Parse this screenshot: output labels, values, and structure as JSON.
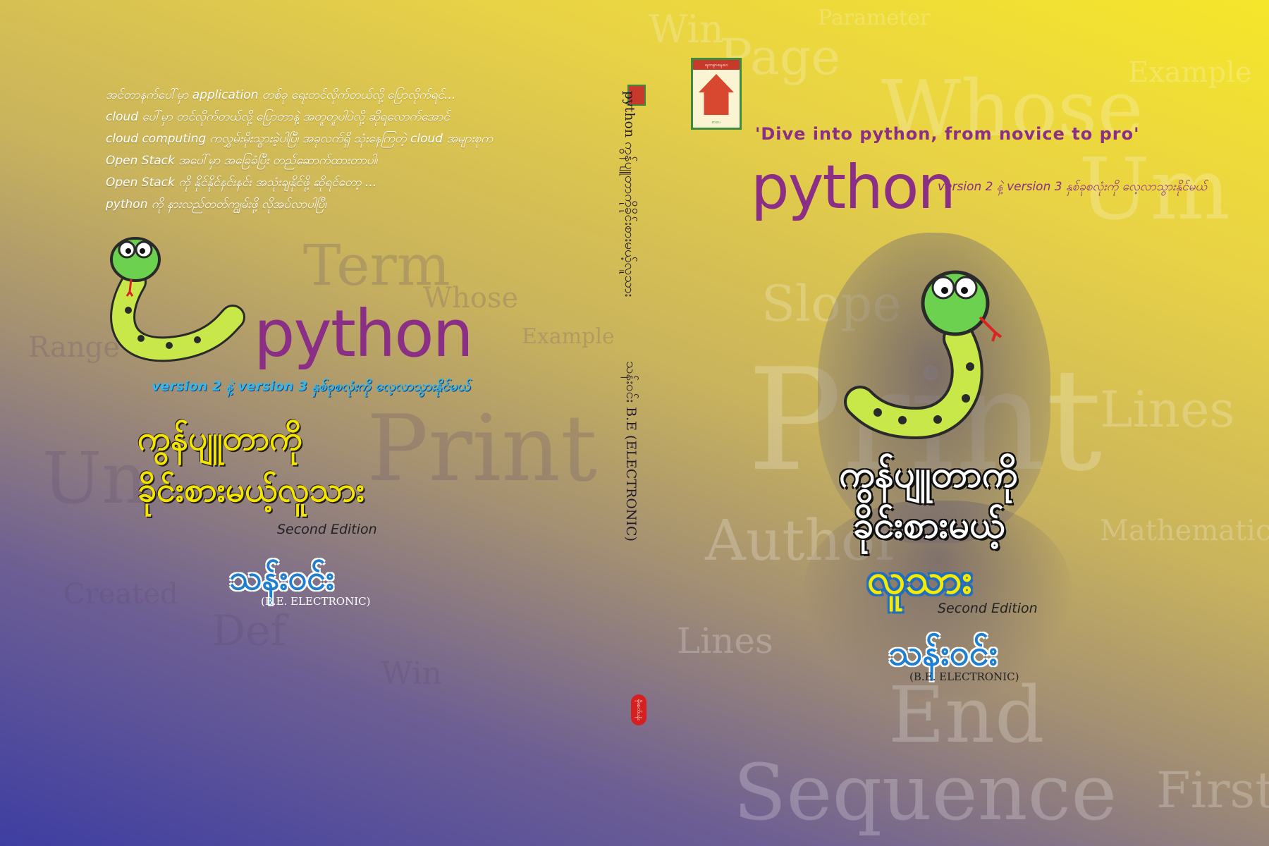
{
  "back_cover": {
    "blurb": [
      "အင်တာနက်ပေါ်မှာ application တစ်ခု ရေးတင်လိုက်တယ်လို့ ပြောလိုက်ရင်...",
      "cloud ပေါ်မှာ တင်လိုက်တယ်လို့ ပြောတာနဲ့ အတူတူပါပဲလို့ ဆိုရလောက်အောင်",
      "cloud computing ကလွှမ်းမိုးသွားခဲ့ပါပြီ၊ အခုလက်ရှိ သုံးနေကြတဲ့ cloud အများစုက",
      "Open Stack အပေါ်မှာ အခြေခံပြီး တည်ဆောက်ထားတာပါ၊",
      "Open Stack ကို နိုင်နိုင်နင်းနင်း အသုံးချနိုင်ဖို့ ဆိုရင်တော့ ...",
      "python ကို နားလည်တတ်ကျွမ်းဖို့ လိုအပ်လာပါပြီ၊"
    ],
    "logo_word": "python",
    "version_note": "version 2 နဲ့ version 3 နှစ်ခုစလုံးကို လေ့လာသွားနိုင်မယ်",
    "title_line1": "ကွန်ပျူတာကို",
    "title_line2": "ခိုင်းစားမယ့်လူသား",
    "edition": "Second Edition",
    "author": "သန်းဝင်း",
    "degree": "(B.E. ELECTRONIC)"
  },
  "spine": {
    "title": "python ကွန်ပျူတာကိုခိုင်းစားမယ့်လူသား",
    "author": "သန်းဝင်း  B.E (ELECTRONIC)",
    "publisher": "မိုးစက်ပန်း"
  },
  "front_cover": {
    "publisher_logo_top": "ရတနာနေဝေ",
    "publisher_logo_bottom": "စာပေ",
    "tagline": "'Dive into python, from novice to pro'",
    "logo_word": "python",
    "version_note": "version 2 နဲ့ version 3 နှစ်ခုစလုံးကို လေ့လာသွားနိုင်မယ်",
    "title_line1": "ကွန်ပျူတာကို",
    "title_line2": "ခိုင်းစားမယ့်",
    "title_line3": "လူသား",
    "edition": "Second Edition",
    "author": "သန်းဝင်း",
    "degree": "(B.E. ELECTRONIC)"
  },
  "colors": {
    "purple": "#8a2e86",
    "yellow": "#f4e400",
    "blue": "#1e7fd1",
    "snake_green": "#c8e84a",
    "snake_head": "#6bd14e"
  }
}
